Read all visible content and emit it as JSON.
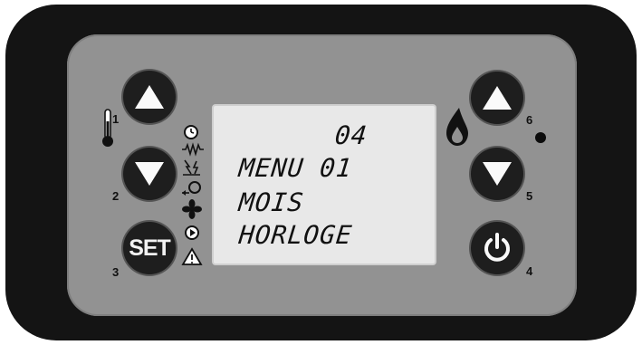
{
  "display": {
    "line1": "04",
    "line2": "MENU 01",
    "line3": "MOIS",
    "line4": "HORLOGE"
  },
  "buttons": {
    "b1": {
      "number": "1",
      "icon": "arrow-up-icon"
    },
    "b2": {
      "number": "2",
      "icon": "arrow-down-icon"
    },
    "b3": {
      "number": "3",
      "label": "SET"
    },
    "b4": {
      "number": "4",
      "icon": "power-icon"
    },
    "b5": {
      "number": "5",
      "icon": "arrow-down-icon"
    },
    "b6": {
      "number": "6",
      "icon": "arrow-up-icon"
    }
  },
  "status_icons": [
    "clock-icon",
    "resistor-icon",
    "spark-icon",
    "chrono-icon",
    "fan-icon",
    "play-icon",
    "warning-icon"
  ],
  "colors": {
    "bezel": "#141414",
    "faceplate": "#929292",
    "lcd": "#e8e8e8",
    "button": "#1e1e1e"
  }
}
